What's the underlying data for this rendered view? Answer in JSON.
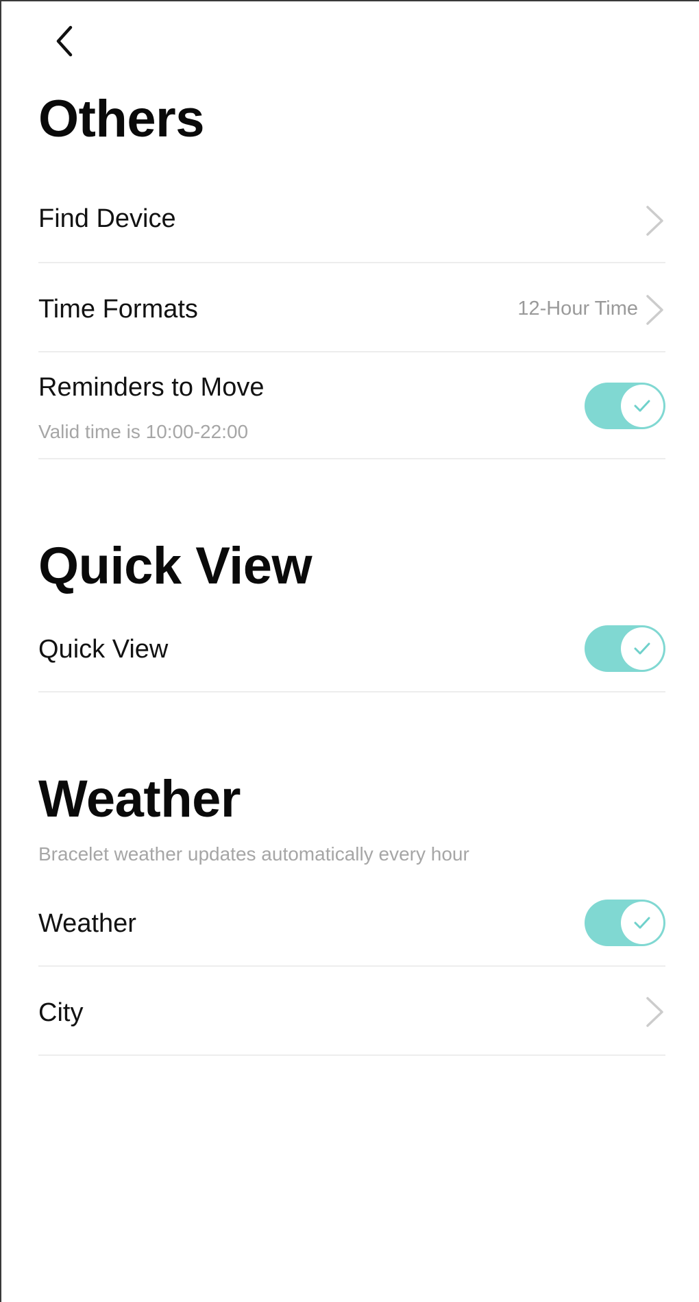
{
  "nav": {
    "back_icon": "chevron-left-icon"
  },
  "others": {
    "title": "Others",
    "find_device": {
      "label": "Find Device"
    },
    "time_formats": {
      "label": "Time Formats",
      "value": "12-Hour Time"
    },
    "reminders": {
      "label": "Reminders to Move",
      "sub": "Valid time is 10:00-22:00",
      "enabled": true
    }
  },
  "quick_view": {
    "title": "Quick View",
    "toggle": {
      "label": "Quick View",
      "enabled": true
    }
  },
  "weather": {
    "title": "Weather",
    "sub": "Bracelet weather updates automatically every hour",
    "toggle": {
      "label": "Weather",
      "enabled": true
    },
    "city": {
      "label": "City"
    }
  },
  "colors": {
    "toggle_on": "#80d8d2",
    "divider": "#ededed",
    "secondary_text": "#a6a6a6"
  }
}
